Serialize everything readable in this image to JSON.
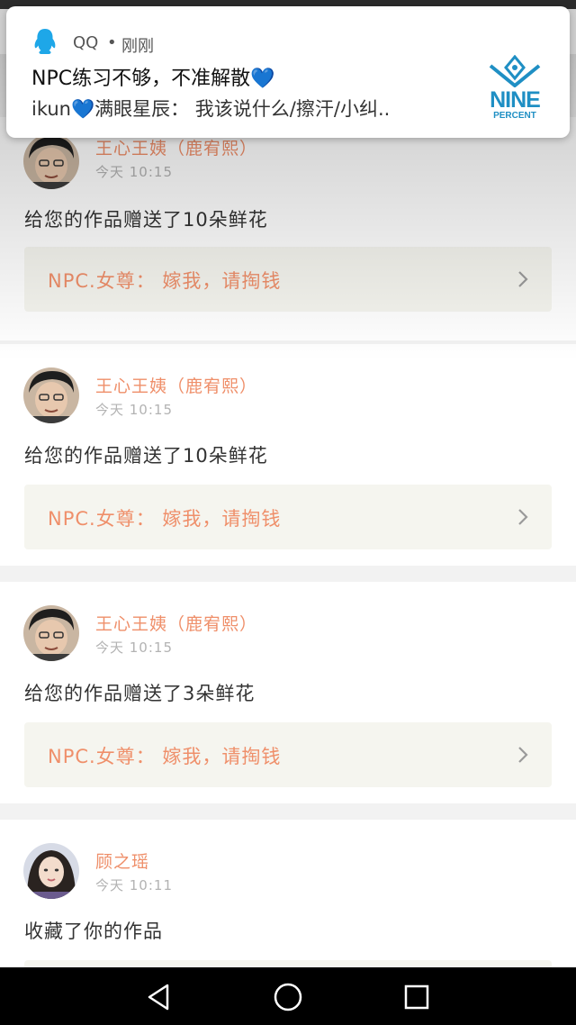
{
  "notification": {
    "app_name": "QQ",
    "separator": "•",
    "time_ago": "刚刚",
    "title": "NPC练习不够，不准解散",
    "title_heart": "💙",
    "body_prefix": "ikun",
    "body_heart": "💙",
    "body_text": "满眼星辰：  我该说什么/擦汗/小纠..",
    "logo_text": "NINE",
    "logo_sub": "PERCENT"
  },
  "feed": [
    {
      "username": "王心王姨（鹿宥熙）",
      "time": "今天  10:15",
      "message": "给您的作品赠送了10朵鲜花",
      "work_title": "NPC.女尊：  嫁我，请掏钱"
    },
    {
      "username": "王心王姨（鹿宥熙）",
      "time": "今天  10:15",
      "message": "给您的作品赠送了10朵鲜花",
      "work_title": "NPC.女尊：  嫁我，请掏钱"
    },
    {
      "username": "王心王姨（鹿宥熙）",
      "time": "今天  10:15",
      "message": "给您的作品赠送了3朵鲜花",
      "work_title": "NPC.女尊：  嫁我，请掏钱"
    },
    {
      "username": "顾之瑶",
      "time": "今天  10:11",
      "message": "收藏了你的作品"
    }
  ],
  "colors": {
    "accent": "#ef8f6a",
    "qq_blue": "#1ea7e8",
    "work_bg": "#f5f5ef",
    "navbar": "#000000"
  },
  "icons": {
    "notification_app": "qq-penguin-icon",
    "chevron": "chevron-right-icon",
    "nav_back": "back-triangle-icon",
    "nav_home": "home-circle-icon",
    "nav_recents": "recents-square-icon"
  }
}
